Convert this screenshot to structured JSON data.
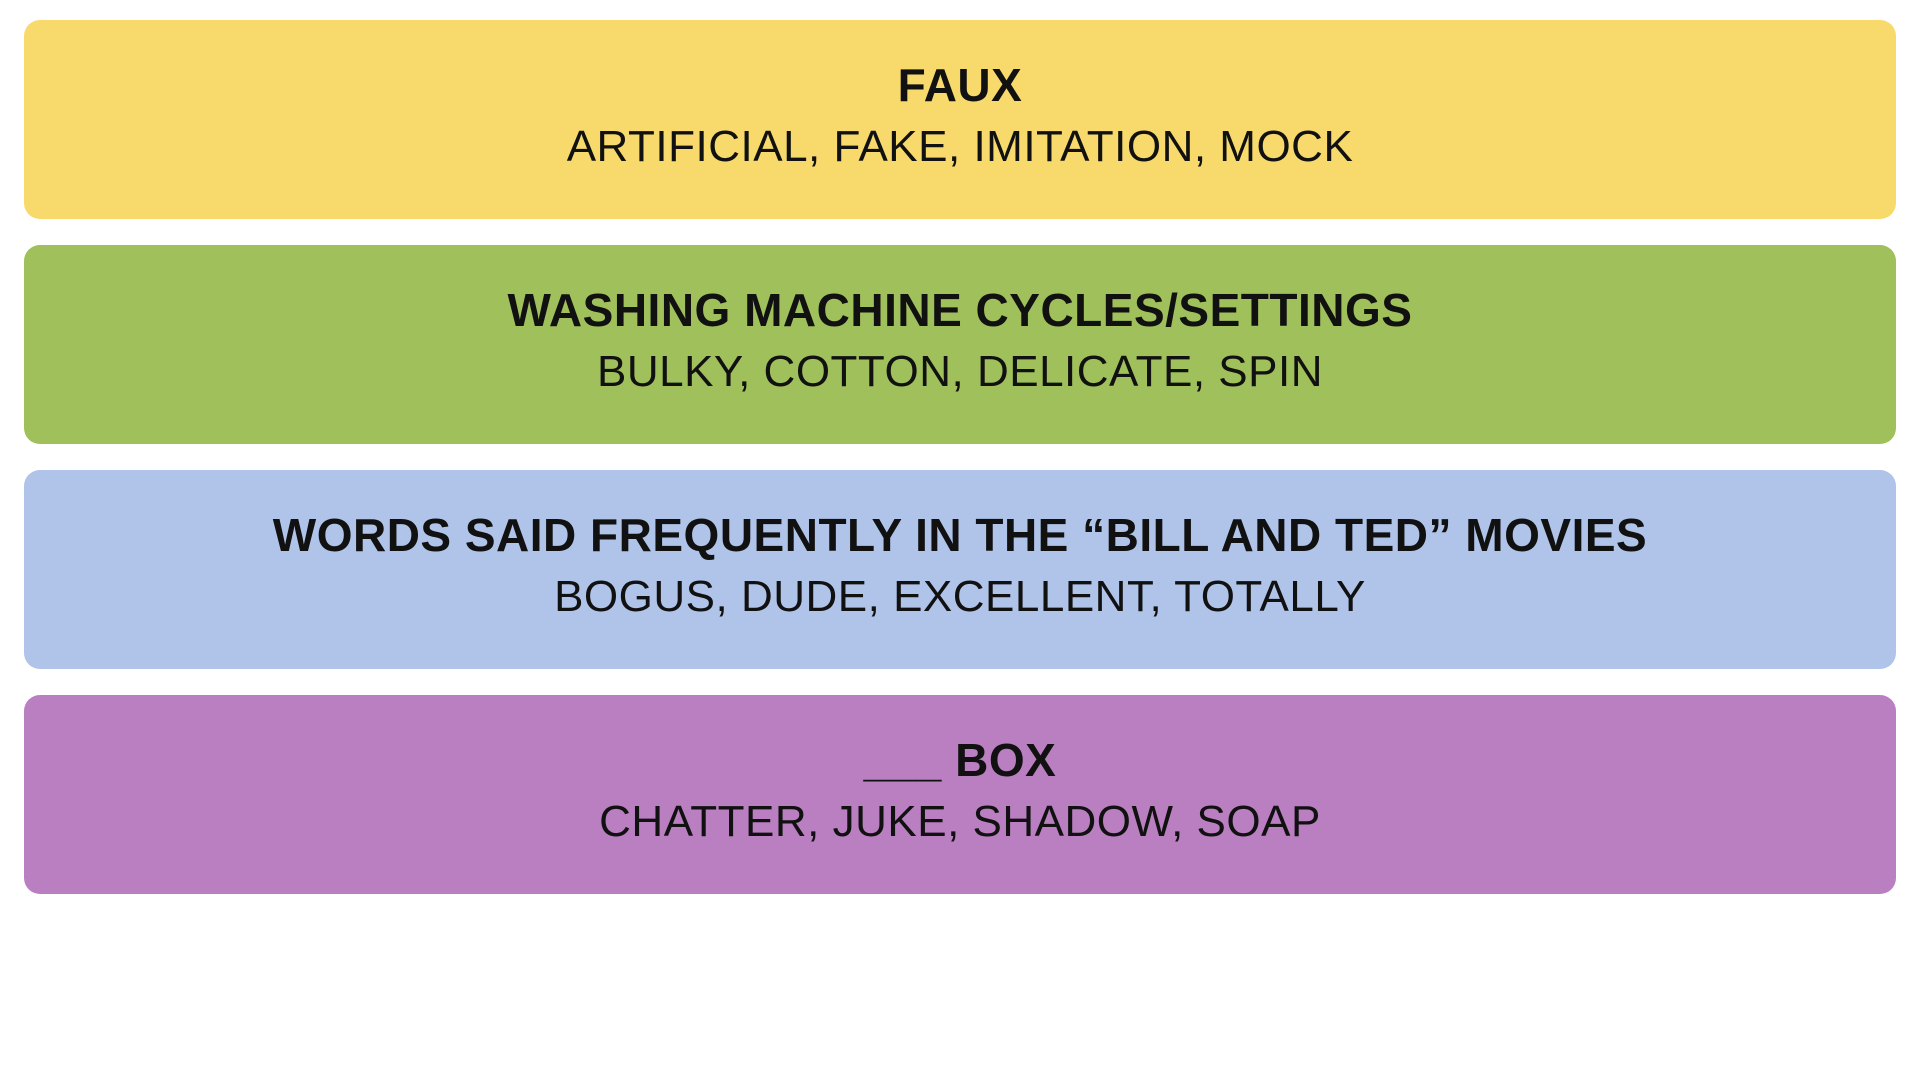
{
  "groups": [
    {
      "color": "yellow",
      "title": "FAUX",
      "words": "ARTIFICIAL, FAKE, IMITATION, MOCK"
    },
    {
      "color": "green",
      "title": "WASHING MACHINE CYCLES/SETTINGS",
      "words": "BULKY, COTTON, DELICATE, SPIN"
    },
    {
      "color": "blue",
      "title": "WORDS SAID FREQUENTLY IN THE “BILL AND TED” MOVIES",
      "words": "BOGUS, DUDE, EXCELLENT, TOTALLY"
    },
    {
      "color": "purple",
      "title": "___ BOX",
      "words": "CHATTER, JUKE, SHADOW, SOAP"
    }
  ]
}
